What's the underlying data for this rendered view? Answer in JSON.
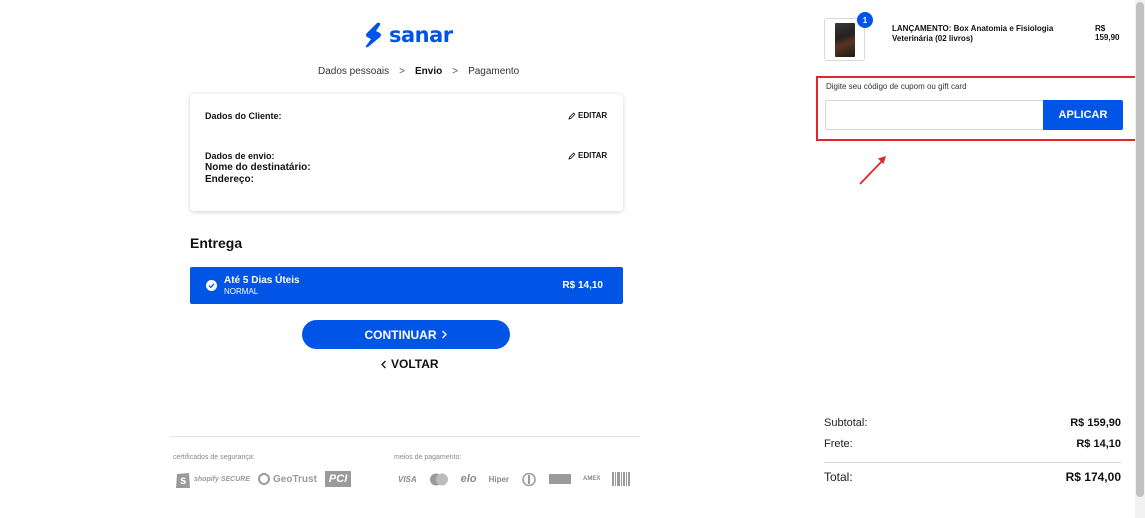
{
  "brand": {
    "logo_text": "sanar",
    "color": "#0054e6"
  },
  "steps": {
    "items": [
      "Dados pessoais",
      "Envio",
      "Pagamento"
    ],
    "active": "Envio",
    "separator": ">"
  },
  "customer_card": {
    "client_label": "Dados do Cliente:",
    "shipping_label": "Dados de envio:",
    "recipient_label": "Nome do destinatário:",
    "address_label": "Endereço:",
    "edit_label": "EDITAR"
  },
  "delivery": {
    "title": "Entrega",
    "option": {
      "name": "Até 5 Dias Úteis",
      "type": "NORMAL",
      "price": "R$ 14,10"
    }
  },
  "actions": {
    "continue_label": "CONTINUAR",
    "back_label": "VOLTAR"
  },
  "footer": {
    "security_label": "certificados de segurança:",
    "payment_label": "meios de pagamento:",
    "security_badges": [
      "shopify SECURE",
      "GeoTrust",
      "PCI"
    ],
    "payment_methods": [
      "VISA",
      "elo",
      "Hiper",
      "AMEX"
    ]
  },
  "order": {
    "product": {
      "name": "LANÇAMENTO: Box Anatomia e Fisiologia Veterinária (02 livros)",
      "price": "R$ 159,90",
      "quantity": "1"
    },
    "coupon": {
      "label": "Digite seu código de cupom ou gift card",
      "value": "",
      "placeholder": "",
      "button": "APLICAR"
    },
    "summary": {
      "subtotal_label": "Subtotal:",
      "subtotal_value": "R$ 159,90",
      "shipping_label": "Frete:",
      "shipping_value": "R$ 14,10",
      "total_label": "Total:",
      "total_value": "R$ 174,00"
    }
  },
  "annotation_color": "#e3262a"
}
